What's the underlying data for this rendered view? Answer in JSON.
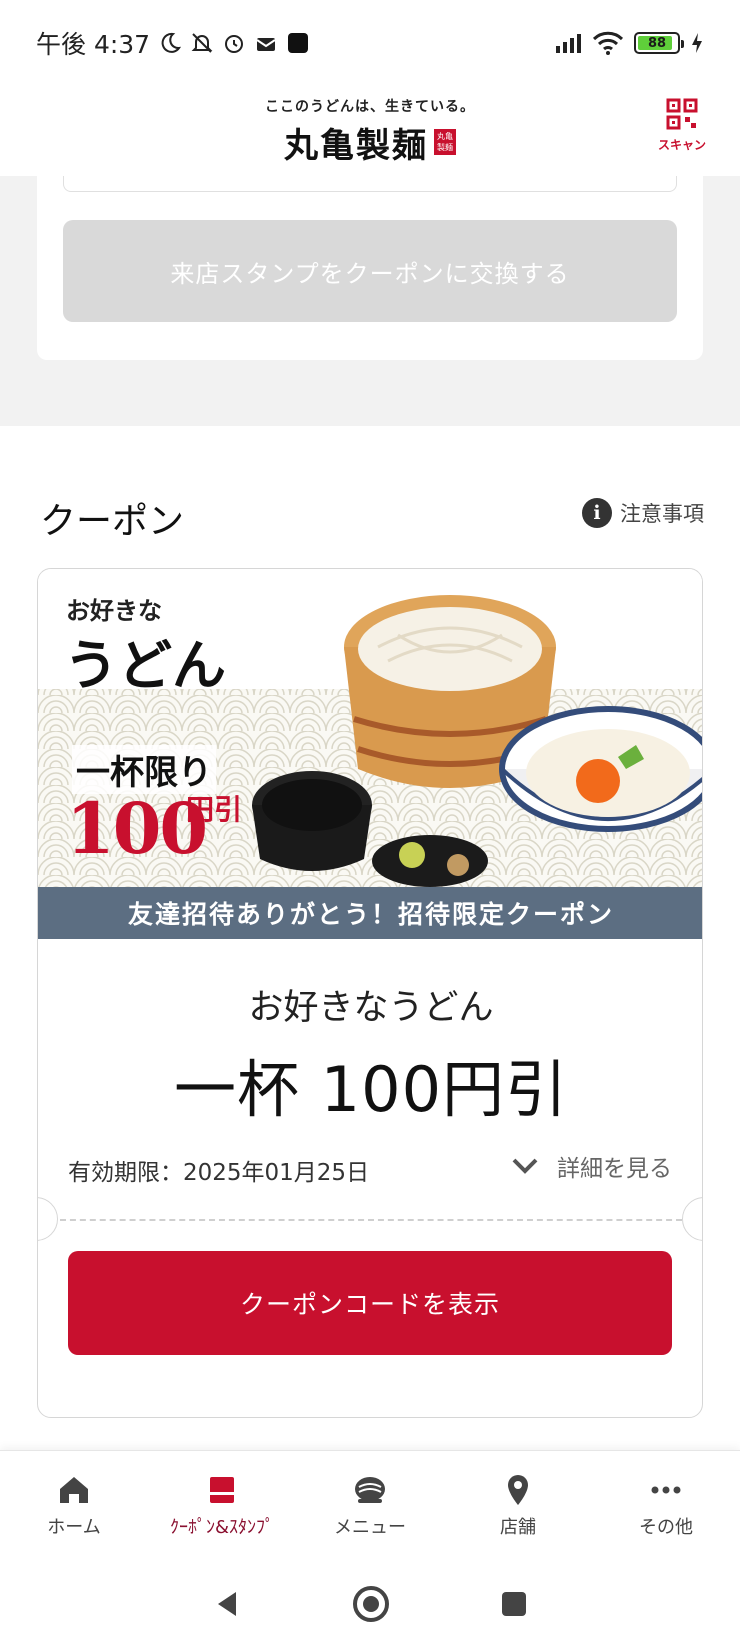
{
  "status_bar": {
    "time": "午後 4:37",
    "battery_level": "88"
  },
  "header": {
    "tagline": "ここのうどんは、生きている。",
    "brand_name": "丸亀製麺",
    "seal_text": "丸亀製麺",
    "scan_label": "スキャン"
  },
  "stamp_section": {
    "exchange_button_label": "来店スタンプをクーポンに交換する"
  },
  "coupon_section": {
    "title": "クーポン",
    "notice_label": "注意事項",
    "coupon": {
      "image_text_small": "お好きな",
      "image_text_large": "うどん",
      "image_text_limit": "一杯限り",
      "image_text_amount": "100",
      "image_text_unit": "円引",
      "banner_text": "友達招待ありがとう！招待限定クーポン",
      "name": "お好きなうどん",
      "discount": "一杯 100円引",
      "expiry": "有効期限：2025年01月25日",
      "detail_label": "詳細を見る",
      "code_button_label": "クーポンコードを表示"
    }
  },
  "bottom_nav": {
    "items": [
      {
        "label": "ホーム",
        "icon": "home-icon",
        "active": false
      },
      {
        "label": "ｸｰﾎﾟﾝ&ｽﾀﾝﾌﾟ",
        "icon": "coupon-stamp-icon",
        "active": true
      },
      {
        "label": "メニュー",
        "icon": "menu-bowl-icon",
        "active": false
      },
      {
        "label": "店舗",
        "icon": "location-pin-icon",
        "active": false
      },
      {
        "label": "その他",
        "icon": "more-icon",
        "active": false
      }
    ]
  },
  "colors": {
    "brand_red": "#c8102e",
    "active_nav": "#8a1030",
    "banner_blue": "#5c6e82",
    "disabled_button": "#d9d9d9"
  }
}
